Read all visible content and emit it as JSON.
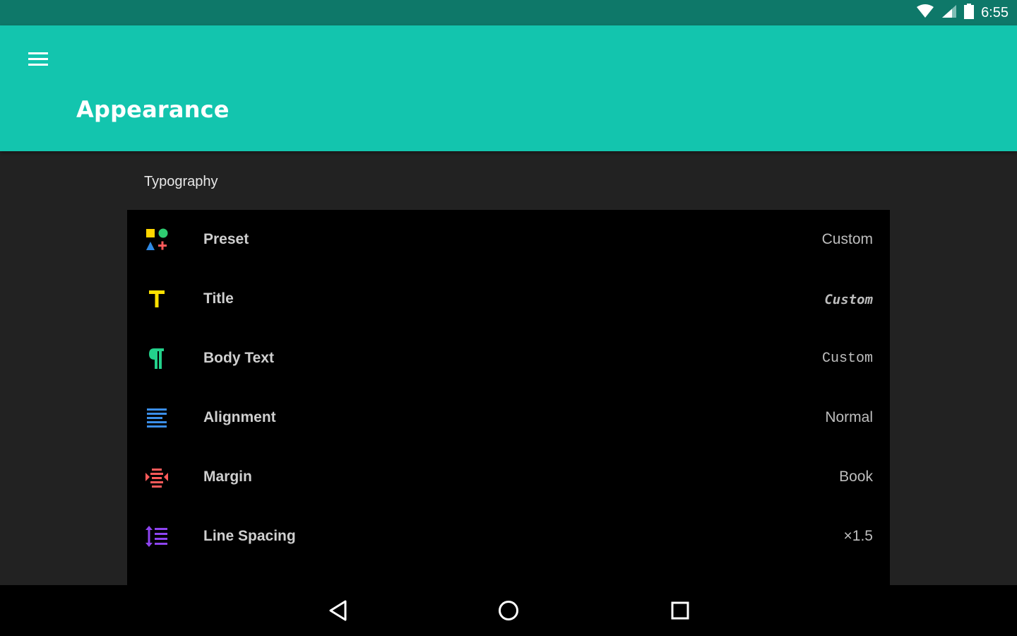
{
  "status_bar": {
    "time": "6:55",
    "icons": [
      "wifi-icon",
      "cell-signal-icon",
      "battery-icon"
    ]
  },
  "app_bar": {
    "title": "Appearance",
    "menu_icon": "hamburger-menu-icon",
    "color": "#13c5ae"
  },
  "section": {
    "title": "Typography"
  },
  "settings": [
    {
      "label": "Preset",
      "value": "Custom",
      "icon": "shapes-icon"
    },
    {
      "label": "Title",
      "value": "Custom",
      "icon": "title-t-icon"
    },
    {
      "label": "Body Text",
      "value": "Custom",
      "icon": "pilcrow-icon"
    },
    {
      "label": "Alignment",
      "value": "Normal",
      "icon": "align-justify-icon"
    },
    {
      "label": "Margin",
      "value": "Book",
      "icon": "margin-icon"
    },
    {
      "label": "Line Spacing",
      "value": "×1.5",
      "icon": "line-spacing-icon"
    }
  ],
  "nav_bar": {
    "icons": [
      "back-icon",
      "home-icon",
      "recents-icon"
    ]
  },
  "colors": {
    "status_bar": "#0e7869",
    "accent": "#13c5ae",
    "background": "#222222",
    "list_background": "#000000"
  }
}
